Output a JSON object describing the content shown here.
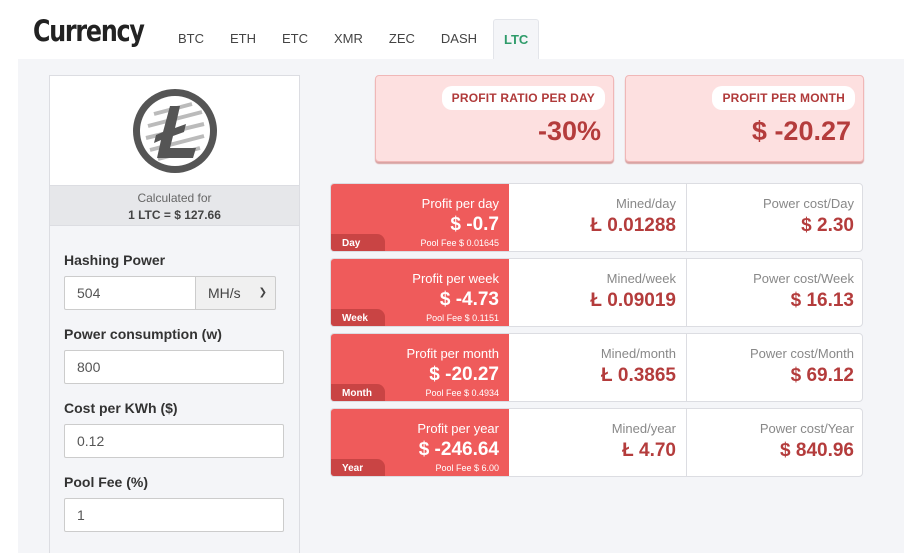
{
  "header": {
    "title": "Currency",
    "tabs": [
      {
        "label": "BTC"
      },
      {
        "label": "ETH"
      },
      {
        "label": "ETC"
      },
      {
        "label": "XMR"
      },
      {
        "label": "ZEC"
      },
      {
        "label": "DASH"
      },
      {
        "label": "LTC",
        "active": true
      }
    ]
  },
  "coin": {
    "icon": "litecoin-icon",
    "calculated_for": "Calculated for",
    "rate": "1 LTC = $ 127.66"
  },
  "form": {
    "hashing_power": {
      "label": "Hashing Power",
      "value": "504",
      "unit": "MH/s"
    },
    "power_consumption": {
      "label": "Power consumption (w)",
      "value": "800"
    },
    "cost_per_kwh": {
      "label": "Cost per KWh ($)",
      "value": "0.12"
    },
    "pool_fee": {
      "label": "Pool Fee (%)",
      "value": "1"
    }
  },
  "summary": {
    "ratio": {
      "label": "PROFIT RATIO PER DAY",
      "value": "-30%"
    },
    "month": {
      "label": "PROFIT PER MONTH",
      "value": "$ -20.27"
    }
  },
  "periods": [
    {
      "tag": "Day",
      "profit_label": "Profit per day",
      "profit": "$ -0.7",
      "fee": "Pool Fee $ 0.01645",
      "mined_label": "Mined/day",
      "mined": "Ł 0.01288",
      "power_label": "Power cost/Day",
      "power": "$ 2.30"
    },
    {
      "tag": "Week",
      "profit_label": "Profit per week",
      "profit": "$ -4.73",
      "fee": "Pool Fee $ 0.1151",
      "mined_label": "Mined/week",
      "mined": "Ł 0.09019",
      "power_label": "Power cost/Week",
      "power": "$ 16.13"
    },
    {
      "tag": "Month",
      "profit_label": "Profit per month",
      "profit": "$ -20.27",
      "fee": "Pool Fee $ 0.4934",
      "mined_label": "Mined/month",
      "mined": "Ł 0.3865",
      "power_label": "Power cost/Month",
      "power": "$ 69.12"
    },
    {
      "tag": "Year",
      "profit_label": "Profit per year",
      "profit": "$ -246.64",
      "fee": "Pool Fee $ 6.00",
      "mined_label": "Mined/year",
      "mined": "Ł 4.70",
      "power_label": "Power cost/Year",
      "power": "$ 840.96"
    }
  ],
  "colors": {
    "accent": "#2e9b6a",
    "loss": "#b43c3c",
    "loss_bg": "#ef5b5b",
    "card_bg": "#fde0e0"
  }
}
